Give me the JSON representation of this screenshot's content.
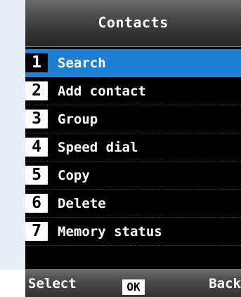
{
  "header": {
    "title": "Contacts"
  },
  "menu": {
    "selected_index": 0,
    "items": [
      {
        "number": "1",
        "label": "Search"
      },
      {
        "number": "2",
        "label": "Add contact"
      },
      {
        "number": "3",
        "label": "Group"
      },
      {
        "number": "4",
        "label": "Speed dial"
      },
      {
        "number": "5",
        "label": "Copy"
      },
      {
        "number": "6",
        "label": "Delete"
      },
      {
        "number": "7",
        "label": "Memory status"
      }
    ]
  },
  "softkeys": {
    "left": "Select",
    "center": "OK",
    "right": "Back"
  },
  "colors": {
    "highlight": "#1e80d2",
    "screen_background": "#000000",
    "side_background": "#e7eef6"
  }
}
